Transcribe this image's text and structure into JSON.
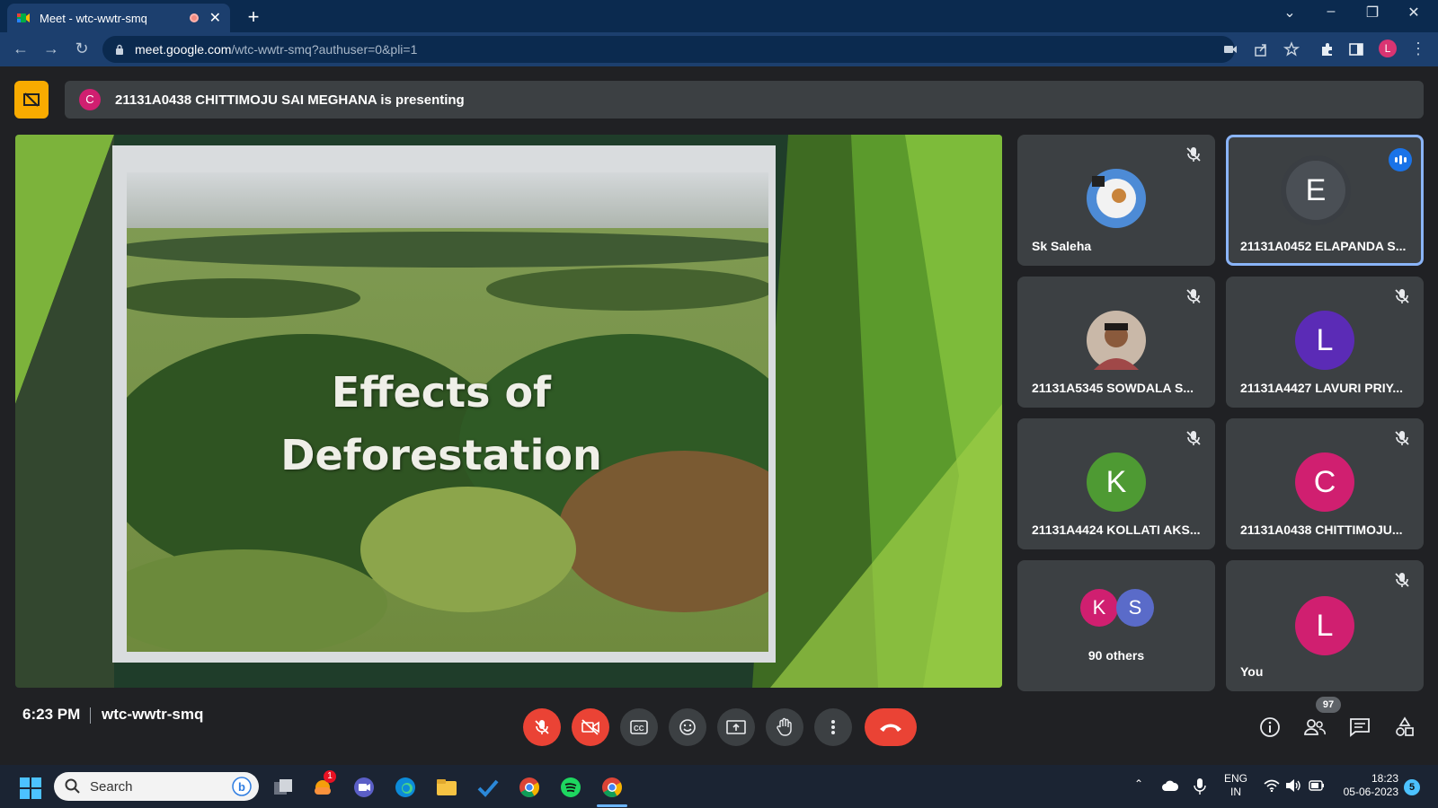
{
  "browser": {
    "tab_title": "Meet - wtc-wwtr-smq",
    "url_host": "meet.google.com",
    "url_path": "/wtc-wwtr-smq?authuser=0&pli=1",
    "profile_initial": "L"
  },
  "meet": {
    "presenter_initial": "C",
    "presenter_banner": "21131A0438 CHITTIMOJU SAI MEGHANA is presenting",
    "slide_title_line1": "Effects of",
    "slide_title_line2": "Deforestation",
    "participants": [
      {
        "name": "Sk Saleha",
        "avatar_type": "photo",
        "muted": true
      },
      {
        "name": "21131A0452 ELAPANDA S...",
        "initial": "E",
        "avatar_color": "#4a4f55",
        "speaking": true
      },
      {
        "name": "21131A5345 SOWDALA S...",
        "avatar_type": "photo",
        "muted": true
      },
      {
        "name": "21131A4427 LAVURI PRIY...",
        "initial": "L",
        "avatar_color": "#5b2bb6",
        "muted": true
      },
      {
        "name": "21131A4424 KOLLATI AKS...",
        "initial": "K",
        "avatar_color": "#4e9a33",
        "muted": true
      },
      {
        "name": "21131A0438 CHITTIMOJU...",
        "initial": "C",
        "avatar_color": "#d01f70",
        "muted": true
      },
      {
        "name": "90 others",
        "initials": [
          "K",
          "S"
        ],
        "avatar_colors": [
          "#d01f70",
          "#5a6bc9"
        ]
      },
      {
        "name": "You",
        "initial": "L",
        "avatar_color": "#d01f70",
        "muted": true
      }
    ],
    "time": "6:23 PM",
    "meeting_code": "wtc-wwtr-smq",
    "participant_count": "97"
  },
  "taskbar": {
    "search_placeholder": "Search",
    "lang_line1": "ENG",
    "lang_line2": "IN",
    "time": "18:23",
    "date": "05-06-2023",
    "notification_count": "5",
    "app_badge": "1"
  }
}
